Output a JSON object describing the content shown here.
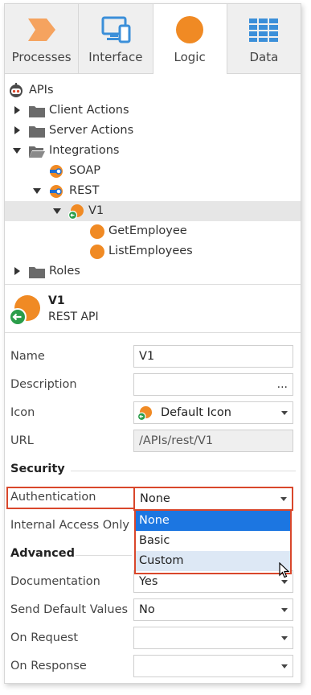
{
  "tabs": [
    {
      "label": "Processes",
      "icon": "processes-icon",
      "active": false
    },
    {
      "label": "Interface",
      "icon": "interface-icon",
      "active": false
    },
    {
      "label": "Logic",
      "icon": "logic-icon",
      "active": true
    },
    {
      "label": "Data",
      "icon": "data-icon",
      "active": false
    }
  ],
  "tree": {
    "root": "APIs",
    "client_actions": "Client Actions",
    "server_actions": "Server Actions",
    "integrations": "Integrations",
    "soap": "SOAP",
    "rest": "REST",
    "v1": "V1",
    "get_employee": "GetEmployee",
    "list_employees": "ListEmployees",
    "roles": "Roles"
  },
  "header": {
    "title": "V1",
    "subtitle": "REST API"
  },
  "properties": {
    "name_label": "Name",
    "name_value": "V1",
    "description_label": "Description",
    "description_value": "",
    "description_button": "...",
    "icon_label": "Icon",
    "icon_value": "Default Icon",
    "url_label": "URL",
    "url_value": "/APIs/rest/V1",
    "security_section": "Security",
    "authentication_label": "Authentication",
    "authentication_value": "None",
    "internal_access_label": "Internal Access Only",
    "advanced_section": "Advanced",
    "documentation_label": "Documentation",
    "documentation_value": "Yes",
    "send_default_label": "Send Default Values",
    "send_default_value": "No",
    "on_request_label": "On Request",
    "on_request_value": "",
    "on_response_label": "On Response",
    "on_response_value": ""
  },
  "auth_options": [
    "None",
    "Basic",
    "Custom"
  ],
  "colors": {
    "accent_orange": "#f08a24",
    "selection_blue": "#1c76e1",
    "highlight_red": "#d9472b",
    "integration_blue": "#1f6fd1"
  }
}
